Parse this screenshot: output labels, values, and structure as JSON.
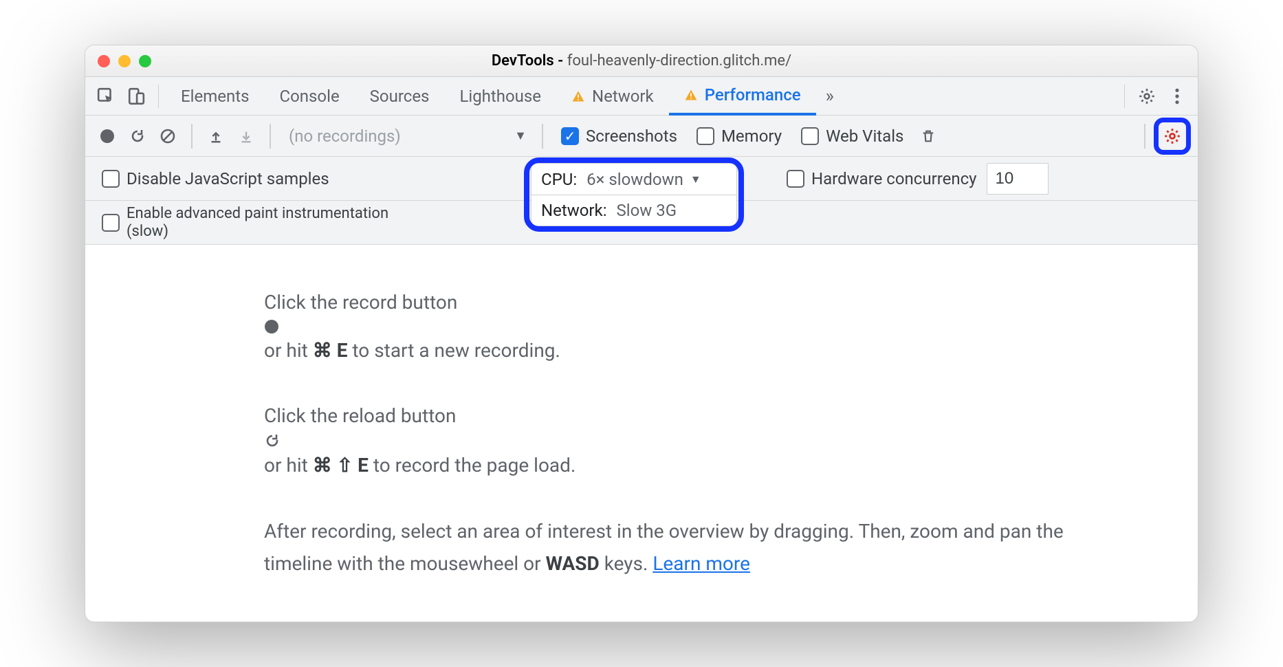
{
  "window": {
    "title_prefix": "DevTools - ",
    "url": "foul-heavenly-direction.glitch.me/"
  },
  "tabs": {
    "items": [
      "Elements",
      "Console",
      "Sources",
      "Lighthouse",
      "Network",
      "Performance"
    ],
    "active_index": 5,
    "more": "»"
  },
  "toolbar": {
    "recordings_placeholder": "(no recordings)",
    "screenshots": "Screenshots",
    "memory": "Memory",
    "webvitals": "Web Vitals"
  },
  "settings": {
    "disable_js": "Disable JavaScript samples",
    "enable_paint_l1": "Enable advanced paint instrumentation",
    "enable_paint_l2": "(slow)",
    "cpu_label": "CPU:",
    "cpu_value": "6× slowdown",
    "net_label": "Network:",
    "net_value": "Slow 3G",
    "hw_label": "Hardware concurrency",
    "hw_value": "10"
  },
  "content": {
    "l1a": "Click the record button ",
    "l1b": " or hit ",
    "l1c": " to start a new recording.",
    "k1a": "⌘",
    "k1b": "E",
    "l2a": "Click the reload button ",
    "l2b": " or hit ",
    "l2c": " to record the page load.",
    "k2a": "⌘",
    "k2b": "⇧",
    "k2c": "E",
    "l3a": "After recording, select an area of interest in the overview by dragging. Then, zoom and pan the timeline with the mousewheel or ",
    "l3b": "WASD",
    "l3c": " keys. ",
    "learn": "Learn more"
  }
}
